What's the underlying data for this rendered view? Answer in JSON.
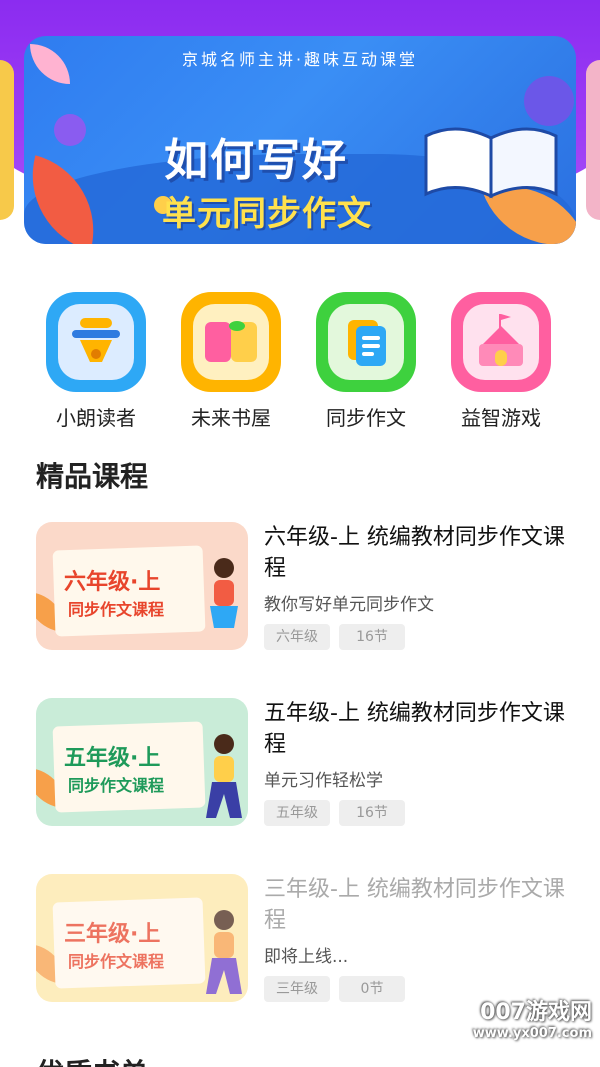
{
  "banner": {
    "subtitle": "京城名师主讲·趣味互动课堂",
    "title_line1": "如何写好",
    "title_line2": "单元同步作文"
  },
  "icons": [
    {
      "label": "小朗读者",
      "icon": "microphone-icon",
      "color": "#2ea8f5"
    },
    {
      "label": "未来书屋",
      "icon": "book-icon",
      "color": "#ffb400"
    },
    {
      "label": "同步作文",
      "icon": "document-icon",
      "color": "#3ed13e"
    },
    {
      "label": "益智游戏",
      "icon": "castle-icon",
      "color": "#ff5fa0"
    }
  ],
  "section_title": "精品课程",
  "courses": [
    {
      "title": "六年级-上 统编教材同步作文课程",
      "desc": "教你写好单元同步作文",
      "tags": [
        "六年级",
        "16节"
      ],
      "thumb_line1": "六年级·上",
      "thumb_line2": "同步作文课程",
      "thumb_bg": "#fbd9c9",
      "thumb_color": "#e8452c",
      "available": true
    },
    {
      "title": "五年级-上 统编教材同步作文课程",
      "desc": "单元习作轻松学",
      "tags": [
        "五年级",
        "16节"
      ],
      "thumb_line1": "五年级·上",
      "thumb_line2": "同步作文课程",
      "thumb_bg": "#c9ecd8",
      "thumb_color": "#1e9a5a",
      "available": true
    },
    {
      "title": "三年级-上 统编教材同步作文课程",
      "desc": "即将上线...",
      "tags": [
        "三年级",
        "0节"
      ],
      "thumb_line1": "三年级·上",
      "thumb_line2": "同步作文课程",
      "thumb_bg": "#fde7a8",
      "thumb_color": "#e8452c",
      "available": false
    }
  ],
  "next_section_title": "优质书单",
  "watermark": {
    "line1": "007游戏网",
    "line2": "www.yx007.com"
  }
}
